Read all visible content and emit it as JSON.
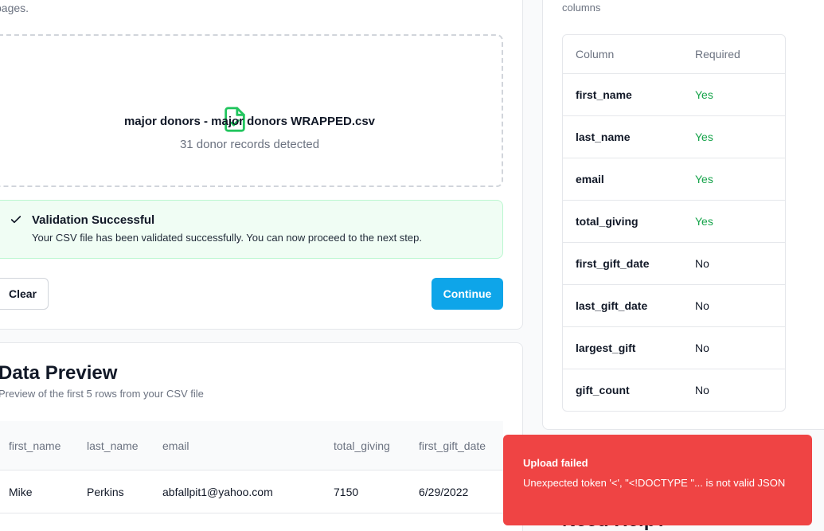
{
  "upload": {
    "truncated_description": "pages.",
    "file_name": "major donors - major donors WRAPPED.csv",
    "records_detected": "31 donor records detected",
    "file_icon": "file-check-icon",
    "accent_color": "#22c55e"
  },
  "alert": {
    "icon": "check-icon",
    "title": "Validation Successful",
    "description": "Your CSV file has been validated successfully. You can now proceed to the next step."
  },
  "actions": {
    "clear_label": "Clear",
    "continue_label": "Continue",
    "continue_color": "#0ea5e9"
  },
  "preview": {
    "title": "Data Preview",
    "subtitle": "Preview of the first 5 rows from your CSV file",
    "columns": [
      "first_name",
      "last_name",
      "email",
      "total_giving",
      "first_gift_date"
    ],
    "rows": [
      [
        "Mike",
        "Perkins",
        "abfallpit1@yahoo.com",
        "7150",
        "6/29/2022"
      ]
    ]
  },
  "required_columns": {
    "truncated_description": "columns",
    "headers": [
      "Column",
      "Required"
    ],
    "items": [
      {
        "column": "first_name",
        "required": "Yes"
      },
      {
        "column": "last_name",
        "required": "Yes"
      },
      {
        "column": "email",
        "required": "Yes"
      },
      {
        "column": "total_giving",
        "required": "Yes"
      },
      {
        "column": "first_gift_date",
        "required": "No"
      },
      {
        "column": "last_gift_date",
        "required": "No"
      },
      {
        "column": "largest_gift",
        "required": "No"
      },
      {
        "column": "gift_count",
        "required": "No"
      }
    ]
  },
  "toast": {
    "title": "Upload failed",
    "description": "Unexpected token '<', \"<!DOCTYPE \"... is not valid JSON",
    "color": "#ef4444"
  },
  "help": {
    "peek_title": "Need Help?"
  }
}
